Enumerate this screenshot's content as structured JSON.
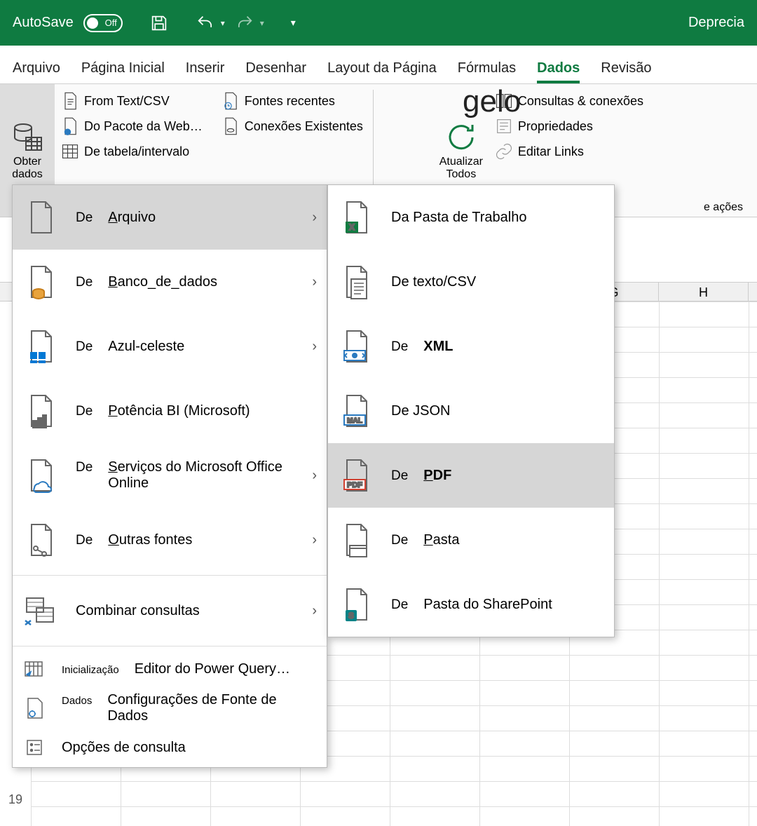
{
  "titlebar": {
    "autosave_label": "AutoSave",
    "autosave_state": "Off",
    "right_text": "Deprecia"
  },
  "tabs": {
    "arquivo": "Arquivo",
    "pagina_inicial": "Página Inicial",
    "inserir": "Inserir",
    "desenhar": "Desenhar",
    "layout": "Layout da Página",
    "formulas": "Fórmulas",
    "dados": "Dados",
    "revisao": "Revisão"
  },
  "ribbon": {
    "obter_dados": "Obter dados",
    "from_text": "From Text/CSV",
    "from_web": "Do Pacote da Web…",
    "from_table": "De tabela/intervalo",
    "fontes_recentes": "Fontes recentes",
    "conexoes_existentes": "Conexões Existentes",
    "atualizar_todos": "Atualizar Todos",
    "consultas_conexoes": "Consultas & conexões",
    "propriedades": "Propriedades",
    "editar_links": "Editar Links",
    "gelo": "gelo",
    "e_acoes": "e ações"
  },
  "columns": [
    "G",
    "H"
  ],
  "row_label": "19",
  "menu1": [
    {
      "pre": "De",
      "main": "Arquivo",
      "ul": "A",
      "icon": "file-icon",
      "arrow": true,
      "hover": true
    },
    {
      "pre": "De",
      "main": "Banco_de_dados",
      "ul": "B",
      "icon": "database-icon",
      "arrow": true
    },
    {
      "pre": "De",
      "main": "Azul-celeste",
      "ul": "",
      "icon": "azure-icon",
      "arrow": true
    },
    {
      "pre": "De",
      "main": "Potência BI (Microsoft)",
      "ul": "P",
      "icon": "powerbi-icon",
      "arrow": false
    },
    {
      "pre": "De",
      "main": "Serviços do Microsoft Office Online",
      "ul": "S",
      "icon": "cloud-icon",
      "arrow": true
    },
    {
      "pre": "De",
      "main": "Outras fontes",
      "ul": "O",
      "icon": "other-icon",
      "arrow": true
    },
    {
      "pre": "",
      "main": "Combinar consultas",
      "ul": "",
      "icon": "combine-icon",
      "arrow": true
    }
  ],
  "menu1_bottom": [
    {
      "pre": "Inicialização",
      "main": "Editor do Power Query…",
      "icon": "launch-icon"
    },
    {
      "pre": "Dados",
      "main": "Configurações de Fonte de Dados",
      "icon": "gear-doc-icon"
    },
    {
      "pre": "",
      "main": "Opções de consulta",
      "icon": "options-icon"
    }
  ],
  "menu2": [
    {
      "pre": "",
      "main": "Da Pasta de Trabalho",
      "icon": "excel-icon",
      "hover": false
    },
    {
      "pre": "",
      "main": "De texto/CSV",
      "icon": "text-icon",
      "hover": false
    },
    {
      "pre": "De",
      "main": "XML",
      "icon": "xml-icon",
      "hover": false
    },
    {
      "pre": "",
      "main": "De JSON",
      "icon": "json-icon",
      "hover": false
    },
    {
      "pre": "De",
      "main": "PDF",
      "ul": "P",
      "icon": "pdf-icon",
      "hover": true
    },
    {
      "pre": "De",
      "main": "Pasta",
      "ul": "P",
      "icon": "folder-icon",
      "hover": false
    },
    {
      "pre": "De",
      "main": "Pasta do SharePoint",
      "icon": "sharepoint-icon",
      "hover": false
    }
  ]
}
